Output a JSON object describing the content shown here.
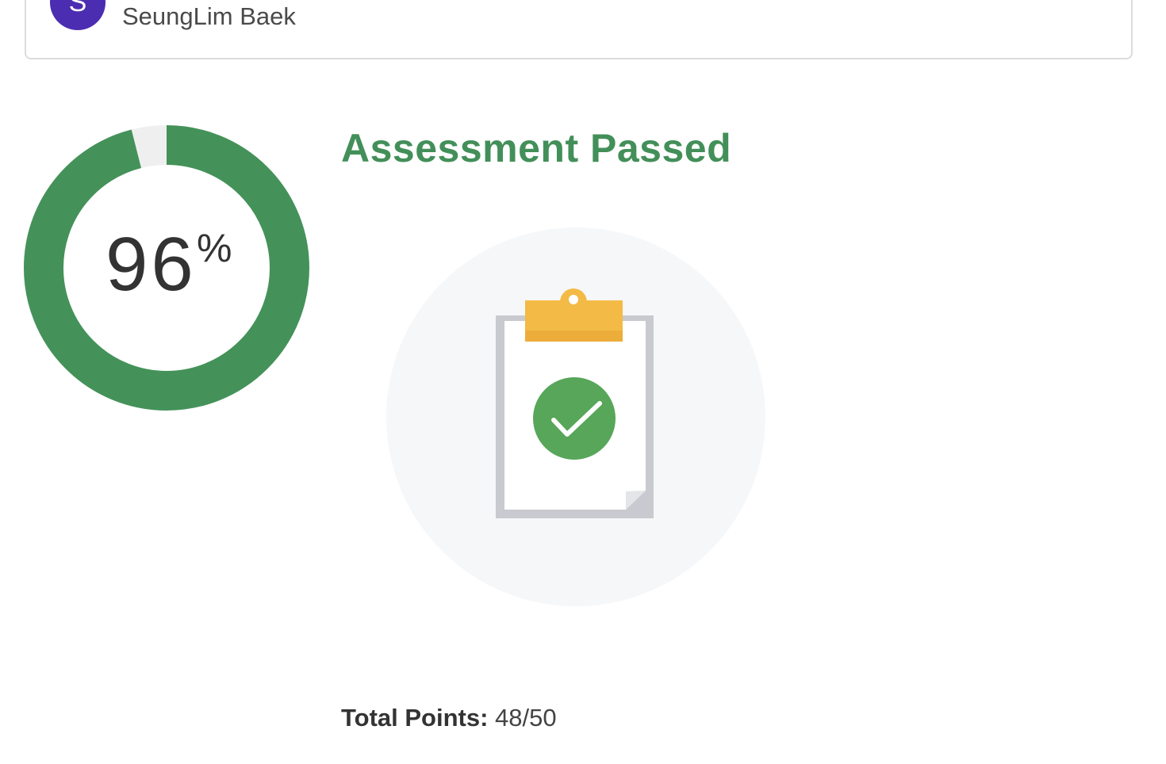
{
  "user": {
    "avatar_initial": "S",
    "name": "SeungLim Baek",
    "avatar_color": "#4b2db1"
  },
  "score": {
    "value": "96",
    "percent_symbol": "%",
    "fraction": 0.96,
    "ring_color": "#449259",
    "track_color": "#efefef"
  },
  "result": {
    "title": "Assessment Passed",
    "color": "#438f59",
    "illustration_icon": "clipboard-check-icon"
  },
  "totals": {
    "label": "Total Points:",
    "value": "48/50"
  }
}
